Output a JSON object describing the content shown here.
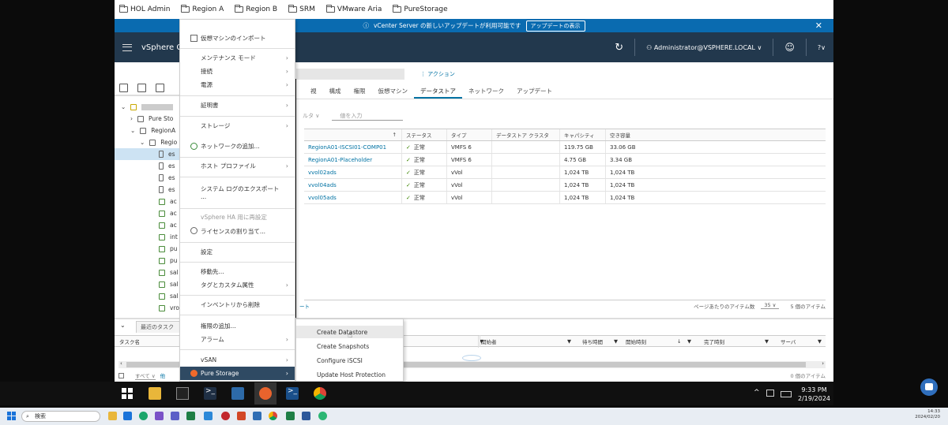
{
  "bookmarks": [
    "HOL Admin",
    "Region A",
    "Region B",
    "SRM",
    "VMware Aria",
    "PureStorage"
  ],
  "banner": {
    "text": "vCenter Server の新しいアップデートが利用可能です",
    "button": "アップデートの表示"
  },
  "header": {
    "title": "vSphere Cl",
    "user": "Administrator@VSPHERE.LOCAL ∨",
    "help": "?∨"
  },
  "sidebar": {
    "tree": [
      {
        "label": "Pure Sto",
        "level": 1
      },
      {
        "label": "RegionA",
        "level": 1
      },
      {
        "label": "Regio",
        "level": 2
      },
      {
        "label": "es",
        "level": 3,
        "selected": true
      },
      {
        "label": "es",
        "level": 3
      },
      {
        "label": "es",
        "level": 3
      },
      {
        "label": "es",
        "level": 3
      },
      {
        "label": "ac",
        "level": 3
      },
      {
        "label": "ac",
        "level": 3
      },
      {
        "label": "ac",
        "level": 3
      },
      {
        "label": "int",
        "level": 3
      },
      {
        "label": "pu",
        "level": 3
      },
      {
        "label": "pu",
        "level": 3
      },
      {
        "label": "sal",
        "level": 3
      },
      {
        "label": "sal",
        "level": 3
      },
      {
        "label": "sal",
        "level": 3
      },
      {
        "label": "vro",
        "level": 3
      }
    ]
  },
  "object": {
    "actions": "アクション"
  },
  "tabs": [
    "視",
    "構成",
    "権限",
    "仮想マシン",
    "データストア",
    "ネットワーク",
    "アップデート"
  ],
  "filter": {
    "label": "ルタ ∨",
    "placeholder": "値を入力"
  },
  "datastores": {
    "columns": [
      "↑",
      "ステータス",
      "タイプ",
      "データストア クラスタ",
      "キャパシティ",
      "空き容量"
    ],
    "rows": [
      {
        "name": "RegionA01-ISCSI01-COMP01",
        "status": "正常",
        "type": "VMFS 6",
        "cluster": "",
        "capacity": "119.75 GB",
        "free": "33.06 GB"
      },
      {
        "name": "RegionA01-Placeholder",
        "status": "正常",
        "type": "VMFS 6",
        "cluster": "",
        "capacity": "4.75 GB",
        "free": "3.34 GB"
      },
      {
        "name": "vvol02ads",
        "status": "正常",
        "type": "vVol",
        "cluster": "",
        "capacity": "1,024 TB",
        "free": "1,024 TB"
      },
      {
        "name": "vvol04ads",
        "status": "正常",
        "type": "vVol",
        "cluster": "",
        "capacity": "1,024 TB",
        "free": "1,024 TB"
      },
      {
        "name": "vvol05ads",
        "status": "正常",
        "type": "vVol",
        "cluster": "",
        "capacity": "1,024 TB",
        "free": "1,024 TB"
      }
    ],
    "footer_left": "ート",
    "footer_per_page": "ページあたりのアイテム数",
    "footer_page_size": "35 ∨",
    "footer_count": "5 個のアイテム"
  },
  "recent_tasks": {
    "tab": "最近のタスク",
    "columns": [
      "タスク名",
      "開始者",
      "待ち時間",
      "開始時刻",
      "完了時刻",
      "サーバ"
    ],
    "filter": "すべて ∨",
    "filter2": "他",
    "count": "0 個のアイテム"
  },
  "context_menu": [
    {
      "label": "仮想マシンのインポート",
      "icon": true
    },
    {
      "label": "メンテナンス モード",
      "sub": true
    },
    {
      "label": "接続",
      "sub": true
    },
    {
      "label": "電源",
      "sub": true
    },
    {
      "label": "証明書",
      "sub": true
    },
    {
      "label": "ストレージ",
      "sub": true
    },
    {
      "label": "ネットワークの追加...",
      "icon": true
    },
    {
      "label": "ホスト プロファイル",
      "sub": true
    },
    {
      "label": "システム ログのエクスポート",
      "line2": "..."
    },
    {
      "label": "vSphere HA 用に再設定",
      "disabled": true
    },
    {
      "label": "ライセンスの割り当て...",
      "icon": true
    },
    {
      "label": "設定"
    },
    {
      "label": "移動先..."
    },
    {
      "label": "タグとカスタム属性",
      "sub": true
    },
    {
      "label": "インベントリから削除"
    },
    {
      "label": "権限の追加..."
    },
    {
      "label": "アラーム",
      "sub": true
    },
    {
      "label": "vSAN",
      "sub": true
    },
    {
      "label": "Pure Storage",
      "sub": true,
      "highlight": true
    }
  ],
  "submenu": [
    "Create Datastore",
    "Create Snapshots",
    "Configure iSCSI",
    "Update Host Protection"
  ],
  "vm_clock": {
    "time": "9:33 PM",
    "date": "2/19/2024"
  },
  "host_taskbar": {
    "search": "検索",
    "time": "14:33",
    "date": "2024/02/20"
  }
}
